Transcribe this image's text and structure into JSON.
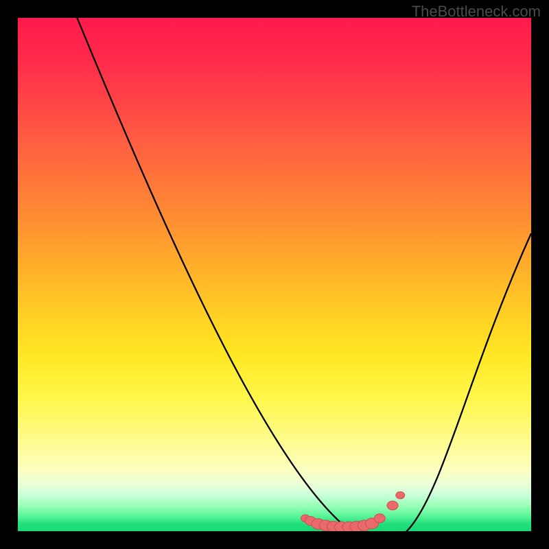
{
  "watermark": "TheBottleneck.com",
  "colors": {
    "gradient_top": "#ff1a4d",
    "gradient_mid": "#ffe824",
    "gradient_bottom": "#16d977",
    "curve": "#000000",
    "marker_fill": "#e96a6a",
    "marker_stroke": "#d24c4c",
    "frame": "#000000"
  },
  "chart_data": {
    "type": "line",
    "title": "",
    "xlabel": "",
    "ylabel": "",
    "xlim": [
      0,
      100
    ],
    "ylim": [
      0,
      100
    ],
    "x": [
      0,
      2,
      4,
      6,
      8,
      10,
      12,
      14,
      16,
      18,
      20,
      22,
      24,
      26,
      28,
      30,
      32,
      34,
      36,
      38,
      40,
      42,
      44,
      46,
      48,
      50,
      52,
      54,
      56,
      58,
      60,
      62,
      64,
      66,
      68,
      70,
      72,
      74,
      76,
      78,
      80,
      82,
      84,
      86,
      88,
      90,
      92,
      94,
      96,
      98,
      100
    ],
    "y": [
      130,
      120,
      112,
      104,
      97,
      90,
      84,
      78,
      72,
      67,
      62,
      57,
      52,
      48,
      44,
      40,
      36,
      32,
      28,
      25,
      22,
      19,
      16,
      13,
      11,
      8,
      6,
      4,
      2.5,
      1.5,
      1,
      0.8,
      0.7,
      0.8,
      1.2,
      2,
      3.5,
      6,
      9,
      12,
      15,
      19,
      23,
      27,
      31,
      36,
      40,
      45,
      49,
      54,
      58
    ],
    "markers": [
      {
        "x": 56,
        "y": 2.5,
        "r": 2
      },
      {
        "x": 57,
        "y": 2.0,
        "r": 2.5
      },
      {
        "x": 58.5,
        "y": 1.4,
        "r": 3
      },
      {
        "x": 60,
        "y": 1.1,
        "r": 3
      },
      {
        "x": 61.5,
        "y": 0.9,
        "r": 3
      },
      {
        "x": 63,
        "y": 0.8,
        "r": 3
      },
      {
        "x": 64.5,
        "y": 0.8,
        "r": 3
      },
      {
        "x": 66,
        "y": 0.9,
        "r": 3
      },
      {
        "x": 67.5,
        "y": 1.1,
        "r": 3
      },
      {
        "x": 69,
        "y": 1.5,
        "r": 3
      },
      {
        "x": 70.5,
        "y": 2.5,
        "r": 2.5
      },
      {
        "x": 73,
        "y": 5.0,
        "r": 2.5
      },
      {
        "x": 74.5,
        "y": 7.0,
        "r": 2
      }
    ]
  }
}
